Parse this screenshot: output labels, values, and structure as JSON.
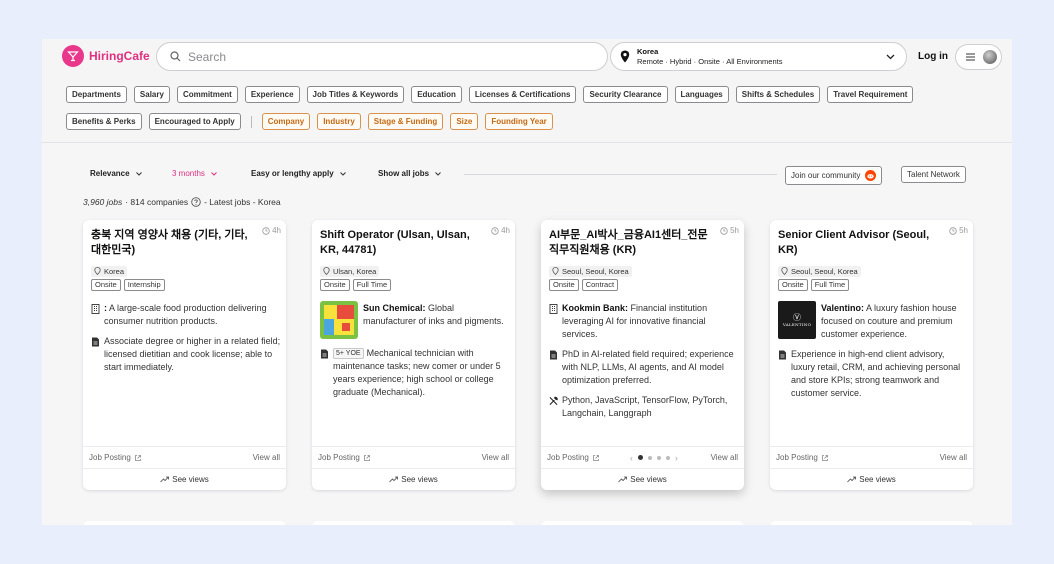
{
  "brand": {
    "name": "HiringCafe",
    "color": "#e9388c"
  },
  "search": {
    "placeholder": "Search"
  },
  "location": {
    "title": "Korea",
    "subtitle": "Remote · Hybrid · Onsite · All Environments"
  },
  "header": {
    "login": "Log in"
  },
  "filters": {
    "row1": [
      "Departments",
      "Salary",
      "Commitment",
      "Experience",
      "Job Titles & Keywords",
      "Education",
      "Licenses & Certifications",
      "Security Clearance",
      "Languages",
      "Shifts & Schedules",
      "Travel Requirement"
    ],
    "row2": [
      "Benefits & Perks",
      "Encouraged to Apply"
    ],
    "company": [
      "Company",
      "Industry",
      "Stage & Funding",
      "Size",
      "Founding Year"
    ]
  },
  "controls": {
    "relevance": "Relevance",
    "date_range": "3 months",
    "apply": "Easy or lengthy apply",
    "show": "Show all jobs",
    "community": "Join our community",
    "talent": "Talent Network"
  },
  "results": {
    "jobs": "3,960 jobs",
    "companies": "· 814 companies",
    "suffix": "- Latest jobs - Korea"
  },
  "cards": [
    {
      "title": "충북 지역 영양사 채용 (기타, 기타, 대한민국)",
      "time": "4h",
      "location": "Korea",
      "tags": [
        "Onsite",
        "Internship"
      ],
      "company": ":",
      "company_desc": "A large-scale food production delivering consumer nutrition products.",
      "req": "Associate degree or higher in a related field; licensed dietitian and cook license; able to start immediately.",
      "posting": "Job Posting",
      "view_all": "View all",
      "see_views": "See views"
    },
    {
      "title": "Shift Operator (Ulsan, Ulsan, KR, 44781)",
      "time": "4h",
      "location": "Ulsan, Korea",
      "tags": [
        "Onsite",
        "Full Time"
      ],
      "company": "Sun Chemical:",
      "company_desc": "Global manufacturer of inks and pigments.",
      "yoe": "5+ YOE",
      "req": "Mechanical technician with maintenance tasks; new comer or under 5 years experience; high school or college graduate (Mechanical).",
      "posting": "Job Posting",
      "view_all": "View all",
      "see_views": "See views"
    },
    {
      "title": "AI부문_AI박사_금융AI1센터_전문직무직원채용 (KR)",
      "time": "5h",
      "location": "Seoul, Seoul, Korea",
      "tags": [
        "Onsite",
        "Contract"
      ],
      "company": "Kookmin Bank:",
      "company_desc": "Financial institution leveraging AI for innovative financial services.",
      "req": "PhD in AI-related field required; experience with NLP, LLMs, AI agents, and AI model optimization preferred.",
      "skills": "Python, JavaScript, TensorFlow, PyTorch, Langchain, Langgraph",
      "posting": "Job Posting",
      "view_all": "View all",
      "see_views": "See views"
    },
    {
      "title": "Senior Client Advisor (Seoul, KR)",
      "time": "5h",
      "location": "Seoul, Seoul, Korea",
      "tags": [
        "Onsite",
        "Full Time"
      ],
      "company": "Valentino:",
      "company_desc": "A luxury fashion house focused on couture and premium customer experience.",
      "logo_text": "VALENTINO",
      "req": "Experience in high-end client advisory, luxury retail, CRM, and achieving personal and store KPIs; strong teamwork and customer service.",
      "posting": "Job Posting",
      "view_all": "View all",
      "see_views": "See views"
    }
  ],
  "colors": {
    "accent": "#e0307f",
    "filter_orange": "#c46a13",
    "page_bg": "#e8eefb"
  }
}
